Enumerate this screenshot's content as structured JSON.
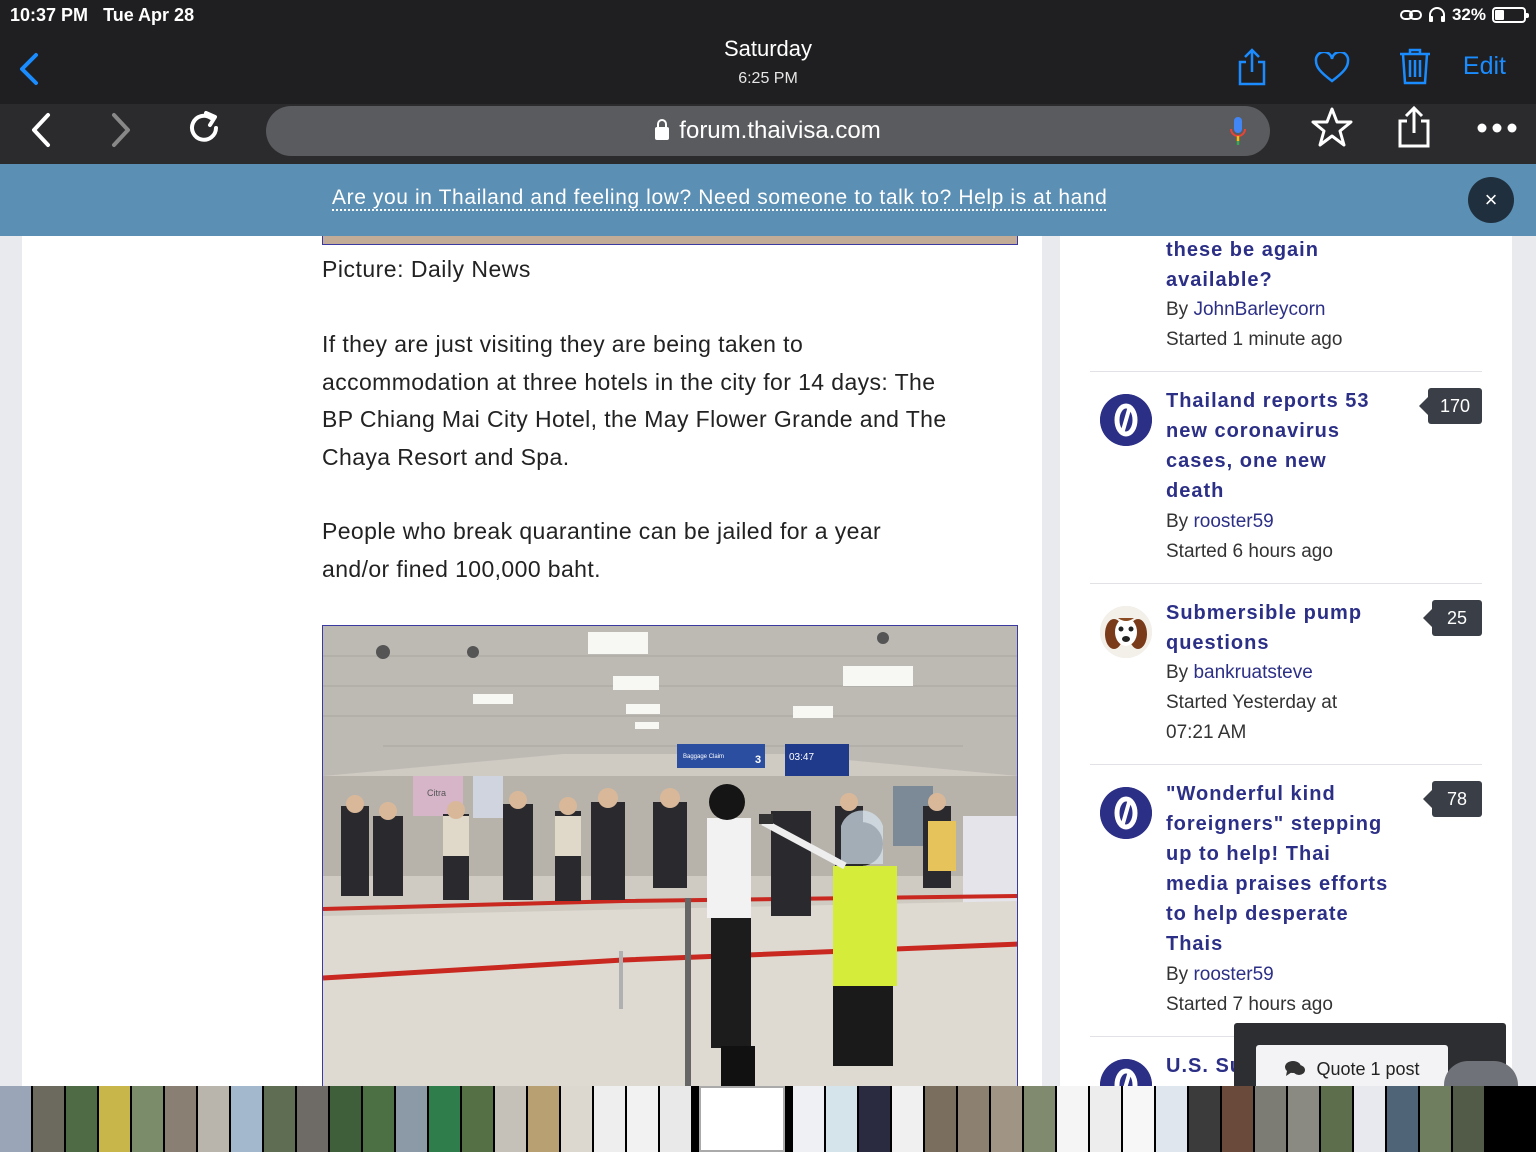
{
  "status_bar": {
    "time": "10:37 PM",
    "date": "Tue Apr 28",
    "battery": "32%"
  },
  "photos_header": {
    "title": "Saturday",
    "subtitle": "6:25 PM",
    "edit_label": "Edit"
  },
  "safari": {
    "url": "forum.thaivisa.com"
  },
  "banner": {
    "text": "Are you in Thailand and feeling low? Need someone to talk to? Help is at hand",
    "close": "×"
  },
  "article": {
    "caption": "Picture: Daily News",
    "para1_lines": [
      "If they are just visiting they are being taken to",
      "accommodation at three hotels in the city for 14 days: The",
      "BP Chiang Mai City Hotel, the May Flower Grande and The",
      "Chaya Resort and Spa."
    ],
    "para2_lines": [
      "People who break quarantine can be jailed for a year",
      "and/or fined 100,000 baht."
    ],
    "photo_signs": {
      "sign1": "Citra",
      "sign2": "03:47",
      "sign3": "Baggage Claim",
      "sign4": "3"
    }
  },
  "sidebar": {
    "topic0": {
      "title_lines": [
        "these be again",
        "available?"
      ],
      "by": "By ",
      "user": "JohnBarleycorn",
      "started": "Started 1 minute ago"
    },
    "topic1": {
      "title_lines": [
        "Thailand reports 53",
        "new coronavirus",
        "cases, one new",
        "death"
      ],
      "by": "By ",
      "user": "rooster59",
      "started": "Started 6 hours ago",
      "replies": "170"
    },
    "topic2": {
      "title_lines": [
        "Submersible pump",
        "questions"
      ],
      "by": "By ",
      "user": "bankruatsteve",
      "started_lines": [
        "Started Yesterday at",
        "07:21 AM"
      ],
      "replies": "25"
    },
    "topic3": {
      "title_lines": [
        "\"Wonderful kind",
        "foreigners\" stepping",
        "up to help! Thai",
        "media praises efforts",
        "to help desperate",
        "Thais"
      ],
      "by": "By ",
      "user": "rooster59",
      "started": "Started 7 hours ago",
      "replies": "78"
    },
    "topic4": {
      "title_partial": "U.S. Su"
    }
  },
  "quote": {
    "label": "Quote 1 post"
  },
  "colors": {
    "link": "#2c2f86",
    "banner": "#5b8fb4",
    "ios_blue": "#1a8cff"
  },
  "icons": [
    "back-chevron-icon",
    "share-icon",
    "heart-icon",
    "trash-icon",
    "reload-icon",
    "mic-icon",
    "star-icon",
    "more-icon",
    "chat-icon"
  ]
}
